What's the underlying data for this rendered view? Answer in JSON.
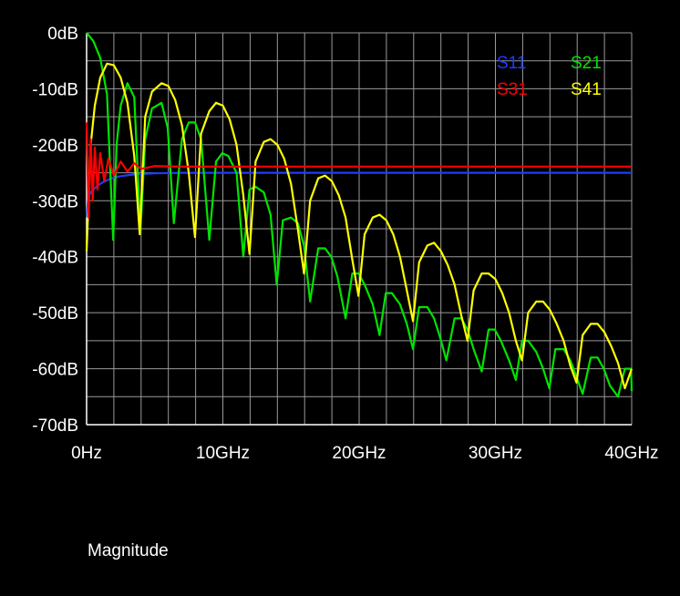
{
  "caption": "Magnitude",
  "colors": {
    "background": "#000000",
    "grid": "#9a9a9a",
    "text": "#ffffff"
  },
  "chart_data": {
    "type": "line",
    "xlabel": "",
    "ylabel": "",
    "x_unit": "GHz",
    "y_unit": "dB",
    "xlim": [
      0,
      40
    ],
    "ylim": [
      -70,
      0
    ],
    "x_ticks": [
      0,
      10,
      20,
      30,
      40
    ],
    "x_tick_labels": [
      "0Hz",
      "10GHz",
      "20GHz",
      "30GHz",
      "40GHz"
    ],
    "y_ticks": [
      0,
      -10,
      -20,
      -30,
      -40,
      -50,
      -60,
      -70
    ],
    "y_tick_labels": [
      "0dB",
      "-10dB",
      "-20dB",
      "-30dB",
      "-40dB",
      "-50dB",
      "-60dB",
      "-70dB"
    ],
    "grid": true,
    "legend_position": "top-right",
    "series": [
      {
        "name": "S11",
        "color": "#1f3bff",
        "x": [
          0,
          0.1,
          0.2,
          0.3,
          0.5,
          0.8,
          1.2,
          1.8,
          2.5,
          3.5,
          5,
          7,
          10,
          15,
          20,
          25,
          30,
          35,
          40
        ],
        "y": [
          -33,
          -30,
          -29,
          -28.5,
          -28,
          -27.3,
          -26.7,
          -26,
          -25.6,
          -25.3,
          -25.1,
          -25,
          -25,
          -25,
          -25,
          -25,
          -25,
          -25,
          -25
        ]
      },
      {
        "name": "S21",
        "color": "#00e400",
        "x": [
          0,
          0.5,
          1,
          1.5,
          1.95,
          2.2,
          2.5,
          3,
          3.5,
          3.95,
          4.3,
          4.8,
          5.5,
          5.95,
          6.4,
          7,
          7.5,
          7.95,
          8.4,
          9,
          9.5,
          9.95,
          10.4,
          11,
          11.5,
          11.95,
          12.4,
          13,
          13.5,
          13.95,
          14.4,
          15,
          15.5,
          15.95,
          16.4,
          17,
          17.5,
          17.95,
          18.4,
          19,
          19.5,
          19.95,
          20.4,
          21,
          21.5,
          21.95,
          22.4,
          23,
          23.5,
          23.95,
          24.4,
          25,
          25.5,
          25.95,
          26.4,
          27,
          27.5,
          27.95,
          28.4,
          29,
          29.5,
          29.95,
          30.4,
          31,
          31.5,
          31.95,
          32.4,
          33,
          33.5,
          33.95,
          34.4,
          35,
          35.5,
          35.95,
          36.4,
          37,
          37.5,
          37.95,
          38.4,
          39,
          39.5,
          39.95,
          40
        ],
        "y": [
          0,
          -1.5,
          -4.5,
          -11,
          -37,
          -20,
          -13,
          -9,
          -11.5,
          -35.5,
          -19,
          -13.5,
          -12.5,
          -17,
          -34,
          -19,
          -16,
          -16,
          -19,
          -37,
          -23,
          -21.5,
          -22,
          -25,
          -40,
          -28,
          -27.5,
          -28.5,
          -32.5,
          -45,
          -33.5,
          -33,
          -34,
          -38,
          -48,
          -38.5,
          -38.5,
          -40,
          -43.5,
          -51,
          -43,
          -43,
          -45,
          -48.5,
          -54,
          -46.5,
          -46.5,
          -48.5,
          -52,
          -56.5,
          -49,
          -49,
          -51,
          -54.5,
          -58.5,
          -51,
          -51,
          -53,
          -56.5,
          -60.5,
          -53,
          -53,
          -55,
          -58.5,
          -62,
          -55,
          -55,
          -57,
          -60,
          -63.5,
          -56.5,
          -56.5,
          -58.5,
          -61.5,
          -64.5,
          -58,
          -58,
          -60,
          -63,
          -65,
          -60,
          -60,
          -64
        ]
      },
      {
        "name": "S31",
        "color": "#ff0000",
        "x": [
          0,
          0.15,
          0.3,
          0.45,
          0.6,
          0.8,
          1,
          1.3,
          1.6,
          2,
          2.5,
          3,
          3.5,
          4,
          5,
          7,
          10,
          15,
          20,
          25,
          30,
          35,
          40
        ],
        "y": [
          -16,
          -33,
          -19,
          -30,
          -20.5,
          -28,
          -21.5,
          -26.5,
          -22.5,
          -25.5,
          -23,
          -24.8,
          -23.3,
          -24.3,
          -23.8,
          -23.9,
          -23.9,
          -23.9,
          -23.9,
          -23.9,
          -23.9,
          -23.9,
          -23.9
        ]
      },
      {
        "name": "S41",
        "color": "#ffff00",
        "x": [
          0,
          0.3,
          0.6,
          1,
          1.5,
          2,
          2.5,
          3,
          3.5,
          3.9,
          4.3,
          4.8,
          5.5,
          6,
          6.5,
          7,
          7.5,
          7.95,
          8.4,
          9,
          9.5,
          10,
          10.5,
          11,
          11.5,
          11.95,
          12.4,
          13,
          13.5,
          14,
          14.5,
          15,
          15.5,
          15.95,
          16.4,
          17,
          17.5,
          18,
          18.5,
          19,
          19.5,
          19.95,
          20.4,
          21,
          21.5,
          22,
          22.5,
          23,
          23.5,
          23.95,
          24.4,
          25,
          25.5,
          26,
          26.5,
          27,
          27.5,
          27.95,
          28.4,
          29,
          29.5,
          30,
          30.5,
          31,
          31.5,
          31.95,
          32.4,
          33,
          33.5,
          34,
          34.5,
          35,
          35.5,
          35.95,
          36.4,
          37,
          37.5,
          38,
          38.5,
          39,
          39.5,
          40
        ],
        "y": [
          -39,
          -20,
          -13,
          -8,
          -5.5,
          -5.8,
          -8,
          -12.5,
          -22,
          -36,
          -15,
          -10.5,
          -9,
          -9.5,
          -12,
          -16.5,
          -25,
          -36.5,
          -18,
          -14,
          -12.5,
          -13,
          -15.5,
          -20,
          -29,
          -39.5,
          -23,
          -19.5,
          -19,
          -20,
          -22.5,
          -27,
          -35,
          -43,
          -30,
          -26,
          -25.5,
          -26.5,
          -29,
          -33,
          -40.5,
          -47,
          -36,
          -33,
          -32.5,
          -33.5,
          -36,
          -40,
          -46,
          -51.5,
          -41,
          -38,
          -37.5,
          -39,
          -41.5,
          -45,
          -50.5,
          -55,
          -46,
          -43,
          -43,
          -44,
          -46.5,
          -50,
          -55,
          -58.5,
          -50,
          -48,
          -48,
          -49.5,
          -52,
          -55,
          -59.5,
          -62.5,
          -54,
          -52,
          -52,
          -53.5,
          -56,
          -59,
          -63.5,
          -60
        ]
      }
    ]
  }
}
